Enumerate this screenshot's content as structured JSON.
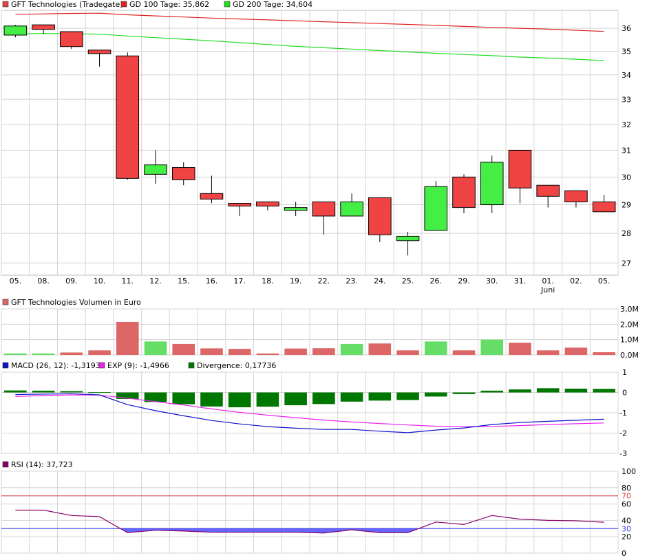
{
  "colors": {
    "up": "#44ee44",
    "down": "#f04444",
    "up_volume": "#66dd66",
    "down_volume": "#dd6666",
    "gd100": "#dd2222",
    "gd200": "#22dd22",
    "macd": "#1111cc",
    "exp": "#ee22ee",
    "divergence": "#007700",
    "rsi": "#880066",
    "rsi_fill": "#6666ff",
    "grid": "#d4d4d4"
  },
  "chart_data": [
    {
      "type": "candlestick",
      "legend": [
        {
          "label": "GFT Technologies (Tradegate)",
          "color": "#dd4444"
        },
        {
          "label": "GD 100 Tage: 35,862",
          "color": "#dd2222"
        },
        {
          "label": "GD 200 Tage: 34,604",
          "color": "#22dd22"
        }
      ],
      "x_labels": [
        "05.",
        "08.",
        "09.",
        "10.",
        "11.",
        "12.",
        "15.",
        "16.",
        "17.",
        "18.",
        "19.",
        "22.",
        "23.",
        "24.",
        "25.",
        "26.",
        "29.",
        "30.",
        "31.",
        "01.",
        "02.",
        "05."
      ],
      "x_sublabel": {
        "index": 19,
        "text": "Juni"
      },
      "y_ticks": [
        27,
        28,
        29,
        30,
        31,
        32,
        33,
        34,
        35,
        36
      ],
      "ylim": [
        26.6,
        36.8
      ],
      "y_scale": "log",
      "candles": [
        {
          "o": 35.7,
          "h": 36.15,
          "l": 35.6,
          "c": 36.1
        },
        {
          "o": 36.15,
          "h": 36.15,
          "l": 35.75,
          "c": 35.95
        },
        {
          "o": 35.85,
          "h": 35.85,
          "l": 35.1,
          "c": 35.2
        },
        {
          "o": 35.05,
          "h": 35.05,
          "l": 34.35,
          "c": 34.9
        },
        {
          "o": 34.8,
          "h": 34.95,
          "l": 29.9,
          "c": 29.95
        },
        {
          "o": 30.1,
          "h": 31.0,
          "l": 29.75,
          "c": 30.45
        },
        {
          "o": 30.35,
          "h": 30.55,
          "l": 29.7,
          "c": 29.9
        },
        {
          "o": 29.4,
          "h": 30.05,
          "l": 29.05,
          "c": 29.2
        },
        {
          "o": 29.05,
          "h": 29.05,
          "l": 28.6,
          "c": 28.95
        },
        {
          "o": 29.1,
          "h": 29.1,
          "l": 28.8,
          "c": 28.95
        },
        {
          "o": 28.8,
          "h": 29.1,
          "l": 28.6,
          "c": 28.9
        },
        {
          "o": 29.1,
          "h": 29.1,
          "l": 27.95,
          "c": 28.6
        },
        {
          "o": 28.6,
          "h": 29.4,
          "l": 28.6,
          "c": 29.1
        },
        {
          "o": 29.25,
          "h": 29.25,
          "l": 27.7,
          "c": 27.95
        },
        {
          "o": 27.75,
          "h": 28.05,
          "l": 27.25,
          "c": 27.9
        },
        {
          "o": 28.1,
          "h": 29.85,
          "l": 28.1,
          "c": 29.65
        },
        {
          "o": 30.0,
          "h": 30.1,
          "l": 28.7,
          "c": 28.9
        },
        {
          "o": 29.0,
          "h": 30.8,
          "l": 28.7,
          "c": 30.55
        },
        {
          "o": 31.0,
          "h": 31.0,
          "l": 29.05,
          "c": 29.6
        },
        {
          "o": 29.7,
          "h": 29.7,
          "l": 28.9,
          "c": 29.3
        },
        {
          "o": 29.5,
          "h": 29.5,
          "l": 28.9,
          "c": 29.1
        },
        {
          "o": 29.1,
          "h": 29.35,
          "l": 28.75,
          "c": 28.75
        }
      ],
      "gd100": [
        36.62,
        36.64,
        36.66,
        36.67,
        36.6,
        36.55,
        36.5,
        36.45,
        36.41,
        36.37,
        36.33,
        36.29,
        36.25,
        36.21,
        36.17,
        36.13,
        36.08,
        36.04,
        36.0,
        35.96,
        35.91,
        35.86
      ],
      "gd200": [
        35.75,
        35.77,
        35.76,
        35.74,
        35.66,
        35.59,
        35.52,
        35.45,
        35.37,
        35.29,
        35.21,
        35.15,
        35.09,
        35.03,
        34.97,
        34.91,
        34.86,
        34.81,
        34.75,
        34.71,
        34.66,
        34.6
      ]
    },
    {
      "type": "bar",
      "title": "GFT Technologies Volumen in Euro",
      "legend_color": "#dd6666",
      "y_ticks": [
        "0,0M",
        "1,0M",
        "2,0M",
        "3,0M"
      ],
      "ylim": [
        0,
        3.0
      ],
      "values": [
        0.1,
        0.1,
        0.16,
        0.3,
        2.15,
        0.88,
        0.72,
        0.43,
        0.4,
        0.1,
        0.42,
        0.44,
        0.72,
        0.75,
        0.3,
        0.88,
        0.3,
        1.0,
        0.8,
        0.3,
        0.48,
        0.18
      ],
      "up": [
        true,
        true,
        false,
        false,
        false,
        true,
        false,
        false,
        false,
        false,
        false,
        false,
        true,
        false,
        false,
        true,
        false,
        true,
        false,
        false,
        false,
        false
      ]
    },
    {
      "type": "line",
      "legend": [
        {
          "label": "MACD (26, 12): -1,3193",
          "color": "#1111cc"
        },
        {
          "label": "EXP (9): -1,4966",
          "color": "#ee22ee"
        },
        {
          "label": "Divergence: 0,17736",
          "color": "#007700"
        }
      ],
      "y_ticks": [
        1,
        0,
        -1,
        -2,
        -3
      ],
      "ylim": [
        -3,
        1
      ],
      "macd": [
        -0.1,
        -0.08,
        -0.06,
        -0.12,
        -0.6,
        -0.9,
        -1.15,
        -1.38,
        -1.55,
        -1.68,
        -1.76,
        -1.82,
        -1.82,
        -1.91,
        -1.98,
        -1.85,
        -1.75,
        -1.58,
        -1.48,
        -1.42,
        -1.37,
        -1.32
      ],
      "exp": [
        -0.2,
        -0.15,
        -0.12,
        -0.13,
        -0.28,
        -0.45,
        -0.62,
        -0.81,
        -0.98,
        -1.12,
        -1.24,
        -1.36,
        -1.45,
        -1.53,
        -1.6,
        -1.66,
        -1.68,
        -1.67,
        -1.63,
        -1.58,
        -1.54,
        -1.5
      ],
      "divergence": [
        0.1,
        0.09,
        0.07,
        0.01,
        -0.32,
        -0.47,
        -0.58,
        -0.69,
        -0.73,
        -0.7,
        -0.63,
        -0.57,
        -0.45,
        -0.4,
        -0.37,
        -0.2,
        -0.08,
        0.09,
        0.15,
        0.21,
        0.19,
        0.18
      ]
    },
    {
      "type": "line",
      "legend": [
        {
          "label": "RSI (14): 37,723",
          "color": "#880066"
        }
      ],
      "y_ticks": [
        0,
        20,
        30,
        40,
        60,
        70,
        80,
        100
      ],
      "ylim": [
        0,
        100
      ],
      "marked_levels": [
        {
          "value": 70,
          "label": "70",
          "color": "#dd4444"
        },
        {
          "value": 30,
          "label": "30",
          "color": "#4444ee"
        }
      ],
      "values": [
        52.5,
        52.5,
        46,
        44.5,
        25,
        28,
        27,
        25.5,
        25.5,
        25.5,
        25.5,
        24.5,
        28.5,
        25,
        25,
        38,
        35,
        46,
        41.5,
        40,
        39.5,
        37.7
      ]
    }
  ]
}
